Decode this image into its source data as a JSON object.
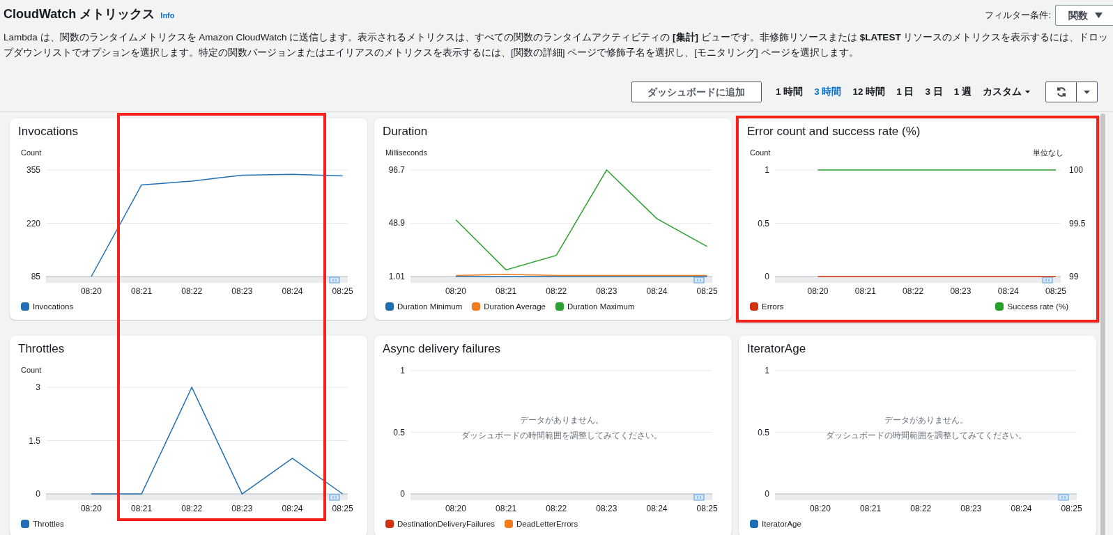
{
  "header": {
    "title": "CloudWatch メトリックス",
    "info_link": "Info",
    "filter_label": "フィルター条件:",
    "filter_value": "関数",
    "description": "Lambda は、関数のランタイムメトリクスを Amazon CloudWatch に送信します。表示されるメトリクスは、すべての関数のランタイムアクティビティの **[集計]** ビューです。非修飾リソースまたは **$LATEST** リソースのメトリクスを表示するには、ドロップダウンリストでオプションを選択します。特定の関数バージョンまたはエイリアスのメトリクスを表示するには、[関数の詳細] ページで修飾子名を選択し、[モニタリング] ページを選択します。"
  },
  "toolbar": {
    "add_button": "ダッシュボードに追加",
    "time_ranges": [
      {
        "label": "1 時間",
        "selected": false
      },
      {
        "label": "3 時間",
        "selected": true
      },
      {
        "label": "12 時間",
        "selected": false
      },
      {
        "label": "1 日",
        "selected": false
      },
      {
        "label": "3 日",
        "selected": false
      },
      {
        "label": "1 週",
        "selected": false
      }
    ],
    "custom_label": "カスタム"
  },
  "column_highlight": true,
  "cards": [
    {
      "title": "Invocations",
      "highlighted": false,
      "chart_data": {
        "type": "line",
        "ylabel": "Count",
        "x": [
          "08:20",
          "08:21",
          "08:22",
          "08:23",
          "08:24",
          "08:25"
        ],
        "ylim": [
          85,
          355
        ],
        "yticks": [
          85,
          220,
          355
        ],
        "series": [
          {
            "name": "Invocations",
            "color": "#1f6fb2",
            "values": [
              85,
              317,
              327,
              342,
              344,
              340
            ]
          }
        ]
      }
    },
    {
      "title": "Duration",
      "highlighted": false,
      "chart_data": {
        "type": "line",
        "ylabel": "Milliseconds",
        "x": [
          "08:20",
          "08:21",
          "08:22",
          "08:23",
          "08:24",
          "08:25"
        ],
        "ylim": [
          1.01,
          96.7
        ],
        "yticks": [
          1.01,
          48.9,
          96.7
        ],
        "series": [
          {
            "name": "Duration Minimum",
            "color": "#1f6fb2",
            "values": [
              1.01,
              1.01,
              1.01,
              1.01,
              1.01,
              1.01
            ]
          },
          {
            "name": "Duration Average",
            "color": "#f07a1e",
            "values": [
              2,
              3,
              2,
              2,
              2,
              2
            ]
          },
          {
            "name": "Duration Maximum",
            "color": "#2ca02c",
            "values": [
              52,
              7,
              20,
              96.7,
              53,
              28
            ]
          }
        ]
      }
    },
    {
      "title": "Error count and success rate (%)",
      "highlighted": true,
      "chart_data": {
        "type": "line",
        "ylabel": "Count",
        "y2label": "単位なし",
        "x": [
          "08:20",
          "08:21",
          "08:22",
          "08:23",
          "08:24",
          "08:25"
        ],
        "ylim": [
          0,
          1
        ],
        "yticks": [
          0,
          0.5,
          1
        ],
        "y2lim": [
          99,
          100
        ],
        "y2ticks": [
          99,
          99.5,
          100
        ],
        "series": [
          {
            "name": "Errors",
            "color": "#d13212",
            "values": [
              0,
              0,
              0,
              0,
              0,
              0
            ]
          },
          {
            "name": "Success rate (%)",
            "color": "#2ca02c",
            "axis": "y2",
            "values": [
              100,
              100,
              100,
              100,
              100,
              100
            ]
          }
        ]
      }
    },
    {
      "title": "Throttles",
      "highlighted": false,
      "chart_data": {
        "type": "line",
        "ylabel": "Count",
        "x": [
          "08:20",
          "08:21",
          "08:22",
          "08:23",
          "08:24",
          "08:25"
        ],
        "ylim": [
          0,
          3
        ],
        "yticks": [
          0,
          1.5,
          3
        ],
        "series": [
          {
            "name": "Throttles",
            "color": "#1f6fb2",
            "values": [
              0,
              0,
              3,
              0,
              1,
              0
            ]
          }
        ]
      }
    },
    {
      "title": "Async delivery failures",
      "highlighted": false,
      "message": [
        "データがありません。",
        "ダッシュボードの時間範囲を調整してみてください。"
      ],
      "chart_data": {
        "type": "line",
        "x": [
          "08:20",
          "08:21",
          "08:22",
          "08:23",
          "08:24",
          "08:25"
        ],
        "ylim": [
          0,
          1
        ],
        "yticks": [
          0,
          0.5,
          1
        ],
        "series": [
          {
            "name": "DestinationDeliveryFailures",
            "color": "#d13212",
            "values": [
              null,
              null,
              null,
              null,
              null,
              null
            ]
          },
          {
            "name": "DeadLetterErrors",
            "color": "#f07a1e",
            "values": [
              null,
              null,
              null,
              null,
              null,
              null
            ]
          }
        ]
      }
    },
    {
      "title": "IteratorAge",
      "highlighted": false,
      "message": [
        "データがありません。",
        "ダッシュボードの時間範囲を調整してみてください。"
      ],
      "chart_data": {
        "type": "line",
        "x": [
          "08:20",
          "08:21",
          "08:22",
          "08:23",
          "08:24",
          "08:25"
        ],
        "ylim": [
          0,
          1
        ],
        "yticks": [
          0,
          0.5,
          1
        ],
        "series": [
          {
            "name": "IteratorAge",
            "color": "#1f6fb2",
            "values": [
              null,
              null,
              null,
              null,
              null,
              null
            ]
          }
        ]
      }
    }
  ]
}
